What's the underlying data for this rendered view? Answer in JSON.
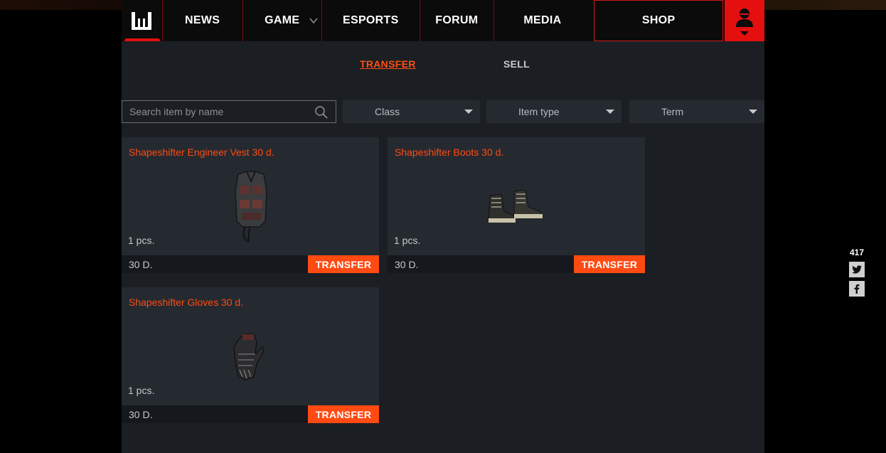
{
  "nav": {
    "items": [
      {
        "id": "news",
        "label": "NEWS"
      },
      {
        "id": "game",
        "label": "GAME"
      },
      {
        "id": "esports",
        "label": "ESPORTS"
      },
      {
        "id": "forum",
        "label": "FORUM"
      },
      {
        "id": "media",
        "label": "MEDIA"
      },
      {
        "id": "shop",
        "label": "SHOP"
      }
    ],
    "accent": "#e60f0f"
  },
  "tabs": {
    "transfer": "TRANSFER",
    "sell": "SELL"
  },
  "filters": {
    "search_placeholder": "Search item by name",
    "class_label": "Class",
    "type_label": "Item type",
    "term_label": "Term"
  },
  "items": [
    {
      "title": "Shapeshifter Engineer Vest 30 d.",
      "qty": "1 pcs.",
      "price": "30 D.",
      "action": "TRANSFER",
      "icon": "vest-icon"
    },
    {
      "title": "Shapeshifter Boots 30 d.",
      "qty": "1 pcs.",
      "price": "30 D.",
      "action": "TRANSFER",
      "icon": "boots-icon"
    },
    {
      "title": "Shapeshifter Gloves 30 d.",
      "qty": "1 pcs.",
      "price": "30 D.",
      "action": "TRANSFER",
      "icon": "gloves-icon"
    }
  ],
  "social": {
    "count": "417",
    "twitter_icon": "twitter-icon",
    "facebook_icon": "facebook-icon"
  },
  "colors": {
    "orange": "#ff4a12",
    "panel": "#1b1f24",
    "card": "#252a30"
  }
}
